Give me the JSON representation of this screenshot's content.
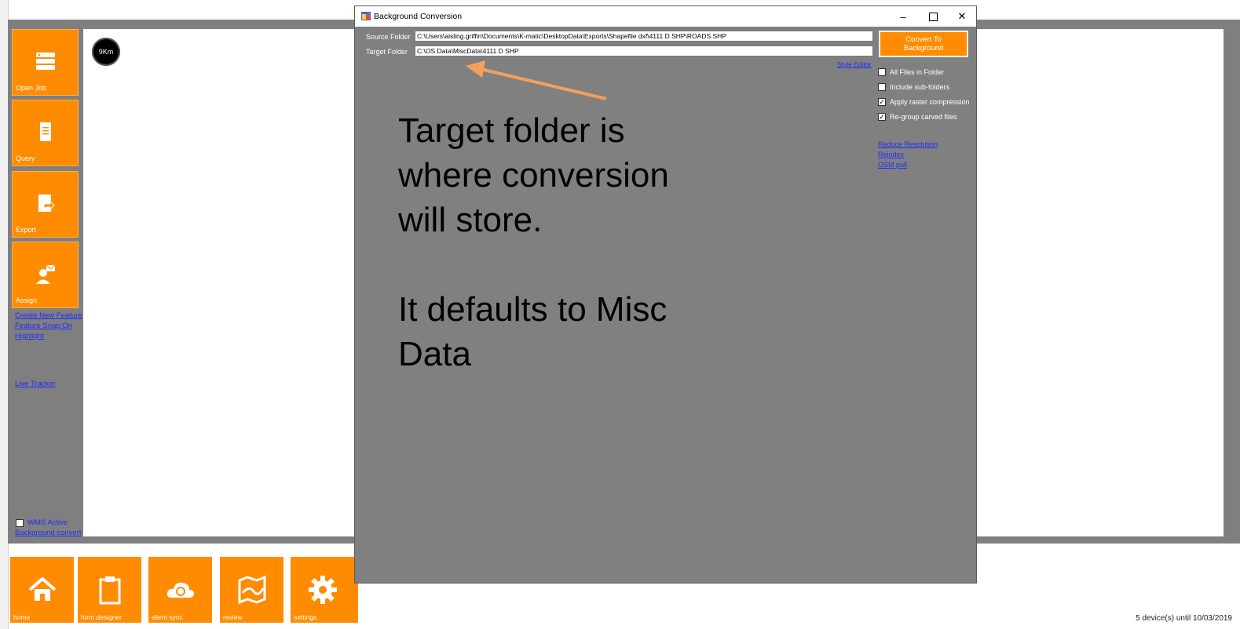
{
  "side_menu": {
    "tiles": [
      {
        "label": "Open Job",
        "icon": "database-icon"
      },
      {
        "label": "Query",
        "icon": "document-icon"
      },
      {
        "label": "Export",
        "icon": "export-icon"
      },
      {
        "label": "Assign",
        "icon": "assign-user-icon"
      }
    ],
    "links": [
      "Create New Feature",
      "Feature Snap:On",
      "Highlight",
      "Live Tracker"
    ],
    "wms_label": "WMS Active",
    "background_convert": "Background convert"
  },
  "map": {
    "scale": "9Km"
  },
  "bottom_bar": {
    "tiles": [
      {
        "label": "home",
        "icon": "home-icon"
      },
      {
        "label": "form designer",
        "icon": "clipboard-icon"
      },
      {
        "label": "silent sync",
        "icon": "cloud-sync-icon"
      },
      {
        "label": "review",
        "icon": "map-icon"
      },
      {
        "label": "settings",
        "icon": "gear-icon"
      }
    ]
  },
  "status": "5 device(s) until 10/03/2019",
  "dialog": {
    "title": "Background Conversion",
    "source_label": "Source Folder",
    "source_value": "C:\\Users\\aisling.griffin\\Documents\\K-matic\\DesktopData\\Exports\\Shapefile dxf\\4111 D SHP\\ROADS.SHP",
    "target_label": "Target Folder",
    "target_value": "C:\\OS Data\\MiscData\\4111 D SHP",
    "convert_button": "Convert To Background",
    "style_editor": "Style Editor",
    "options": [
      {
        "label": "All Files in Folder",
        "checked": false
      },
      {
        "label": "Include sub-folders",
        "checked": false
      },
      {
        "label": "Apply raster compression",
        "checked": true
      },
      {
        "label": "Re-group carved files",
        "checked": true
      }
    ],
    "links": [
      "Reduce Resolution",
      "Reindex",
      "OSM pull"
    ]
  },
  "annotation": {
    "lines": [
      "Target folder is",
      "where conversion",
      "will store.",
      "",
      "It defaults to Misc",
      "Data"
    ]
  },
  "colors": {
    "accent": "#ff8c00",
    "arrow": "#f5a05a",
    "frame": "#7f7f7f",
    "link": "#1f2cff"
  }
}
